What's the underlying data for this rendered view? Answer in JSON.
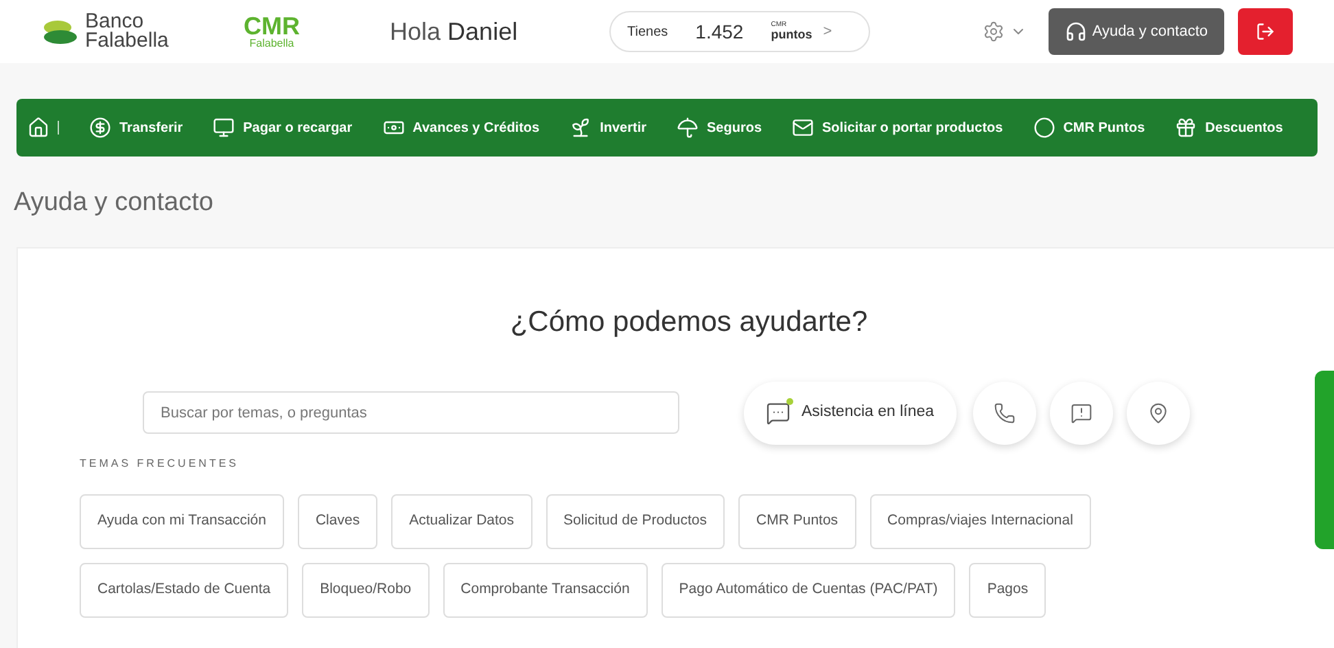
{
  "header": {
    "bank_logo": [
      "Banco",
      "Falabella"
    ],
    "cmr_logo": [
      "CMR",
      "Falabella"
    ],
    "greeting": "Hola",
    "user": "Daniel",
    "points": {
      "label": "Tienes",
      "value": "1.452",
      "unit_top": "CMR",
      "unit": "puntos",
      "arrow": ">"
    },
    "help_button": "Ayuda y contacto"
  },
  "nav": [
    {
      "kind": "home"
    },
    {
      "kind": "money",
      "label": "Transferir"
    },
    {
      "kind": "screen",
      "label": "Pagar o recargar"
    },
    {
      "kind": "cash",
      "label": "Avances y Créditos"
    },
    {
      "kind": "plant",
      "label": "Invertir"
    },
    {
      "kind": "umbrella",
      "label": "Seguros"
    },
    {
      "kind": "card",
      "label": "Solicitar o portar productos"
    },
    {
      "kind": "points",
      "label": "CMR Puntos"
    },
    {
      "kind": "gift",
      "label": "Descuentos"
    }
  ],
  "page_title": "Ayuda y contacto",
  "help": {
    "heading": "¿Cómo podemos ayudarte?",
    "search": {
      "placeholder": "Buscar por temas, o preguntas"
    },
    "chat_button": "Asistencia en línea",
    "icon_buttons": [
      {
        "kind": "phone"
      },
      {
        "kind": "alert"
      },
      {
        "kind": "location"
      }
    ],
    "topics_label": "TEMAS FRECUENTES",
    "topics": [
      [
        "Ayuda con mi Transacción",
        "Claves",
        "Actualizar Datos",
        "Solicitud de Productos",
        "CMR Puntos",
        "Compras/viajes Internacional"
      ],
      [
        "Cartolas/Estado de Cuenta",
        "Bloqueo/Robo",
        "Comprobante Transacción",
        "Pago Automático de Cuentas (PAC/PAT)",
        "Pagos"
      ]
    ]
  }
}
